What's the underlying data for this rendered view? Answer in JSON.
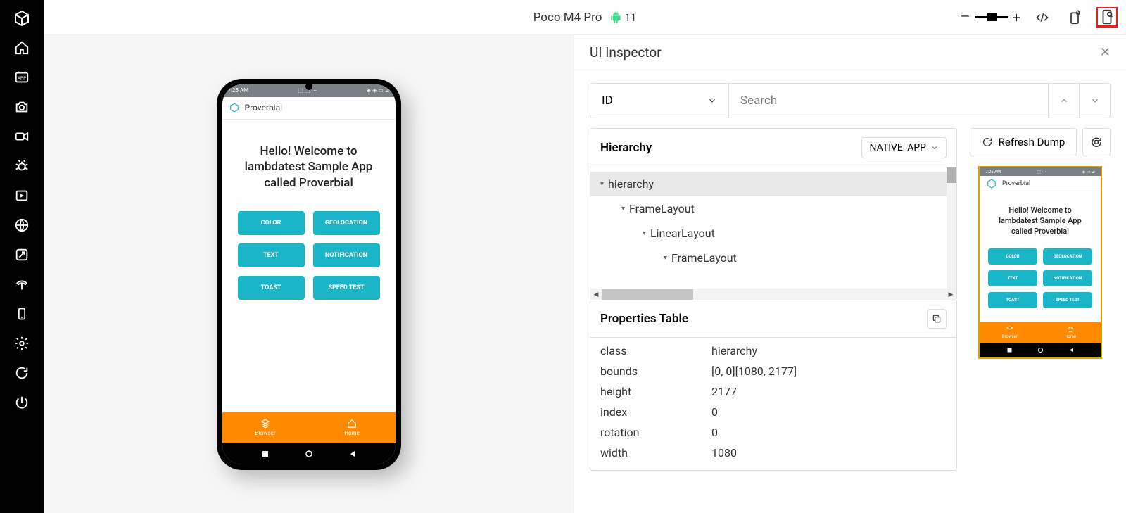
{
  "topbar": {
    "device_name": "Poco M4 Pro",
    "os_version": "11"
  },
  "inspector": {
    "title": "UI Inspector",
    "locator_type": "ID",
    "search_placeholder": "Search",
    "hierarchy_label": "Hierarchy",
    "context": "NATIVE_APP",
    "refresh_label": "Refresh Dump",
    "tree": [
      {
        "label": "hierarchy",
        "depth": 0,
        "selected": true
      },
      {
        "label": "FrameLayout",
        "depth": 1,
        "selected": false
      },
      {
        "label": "LinearLayout",
        "depth": 2,
        "selected": false
      },
      {
        "label": "FrameLayout",
        "depth": 3,
        "selected": false
      }
    ],
    "properties_label": "Properties Table",
    "properties": [
      {
        "k": "class",
        "v": "hierarchy"
      },
      {
        "k": "bounds",
        "v": "[0, 0][1080, 2177]"
      },
      {
        "k": "height",
        "v": "2177"
      },
      {
        "k": "index",
        "v": "0"
      },
      {
        "k": "rotation",
        "v": "0"
      },
      {
        "k": "width",
        "v": "1080"
      }
    ]
  },
  "app": {
    "status_time": "7:25 AM",
    "title": "Proverbial",
    "welcome_l1": "Hello! Welcome to",
    "welcome_l2": "lambdatest Sample App",
    "welcome_l3": "called Proverbial",
    "buttons": [
      "COLOR",
      "GEOLOCATION",
      "TEXT",
      "NOTIFICATION",
      "TOAST",
      "SPEED TEST"
    ],
    "nav": {
      "browser": "Browser",
      "home": "Home"
    }
  }
}
